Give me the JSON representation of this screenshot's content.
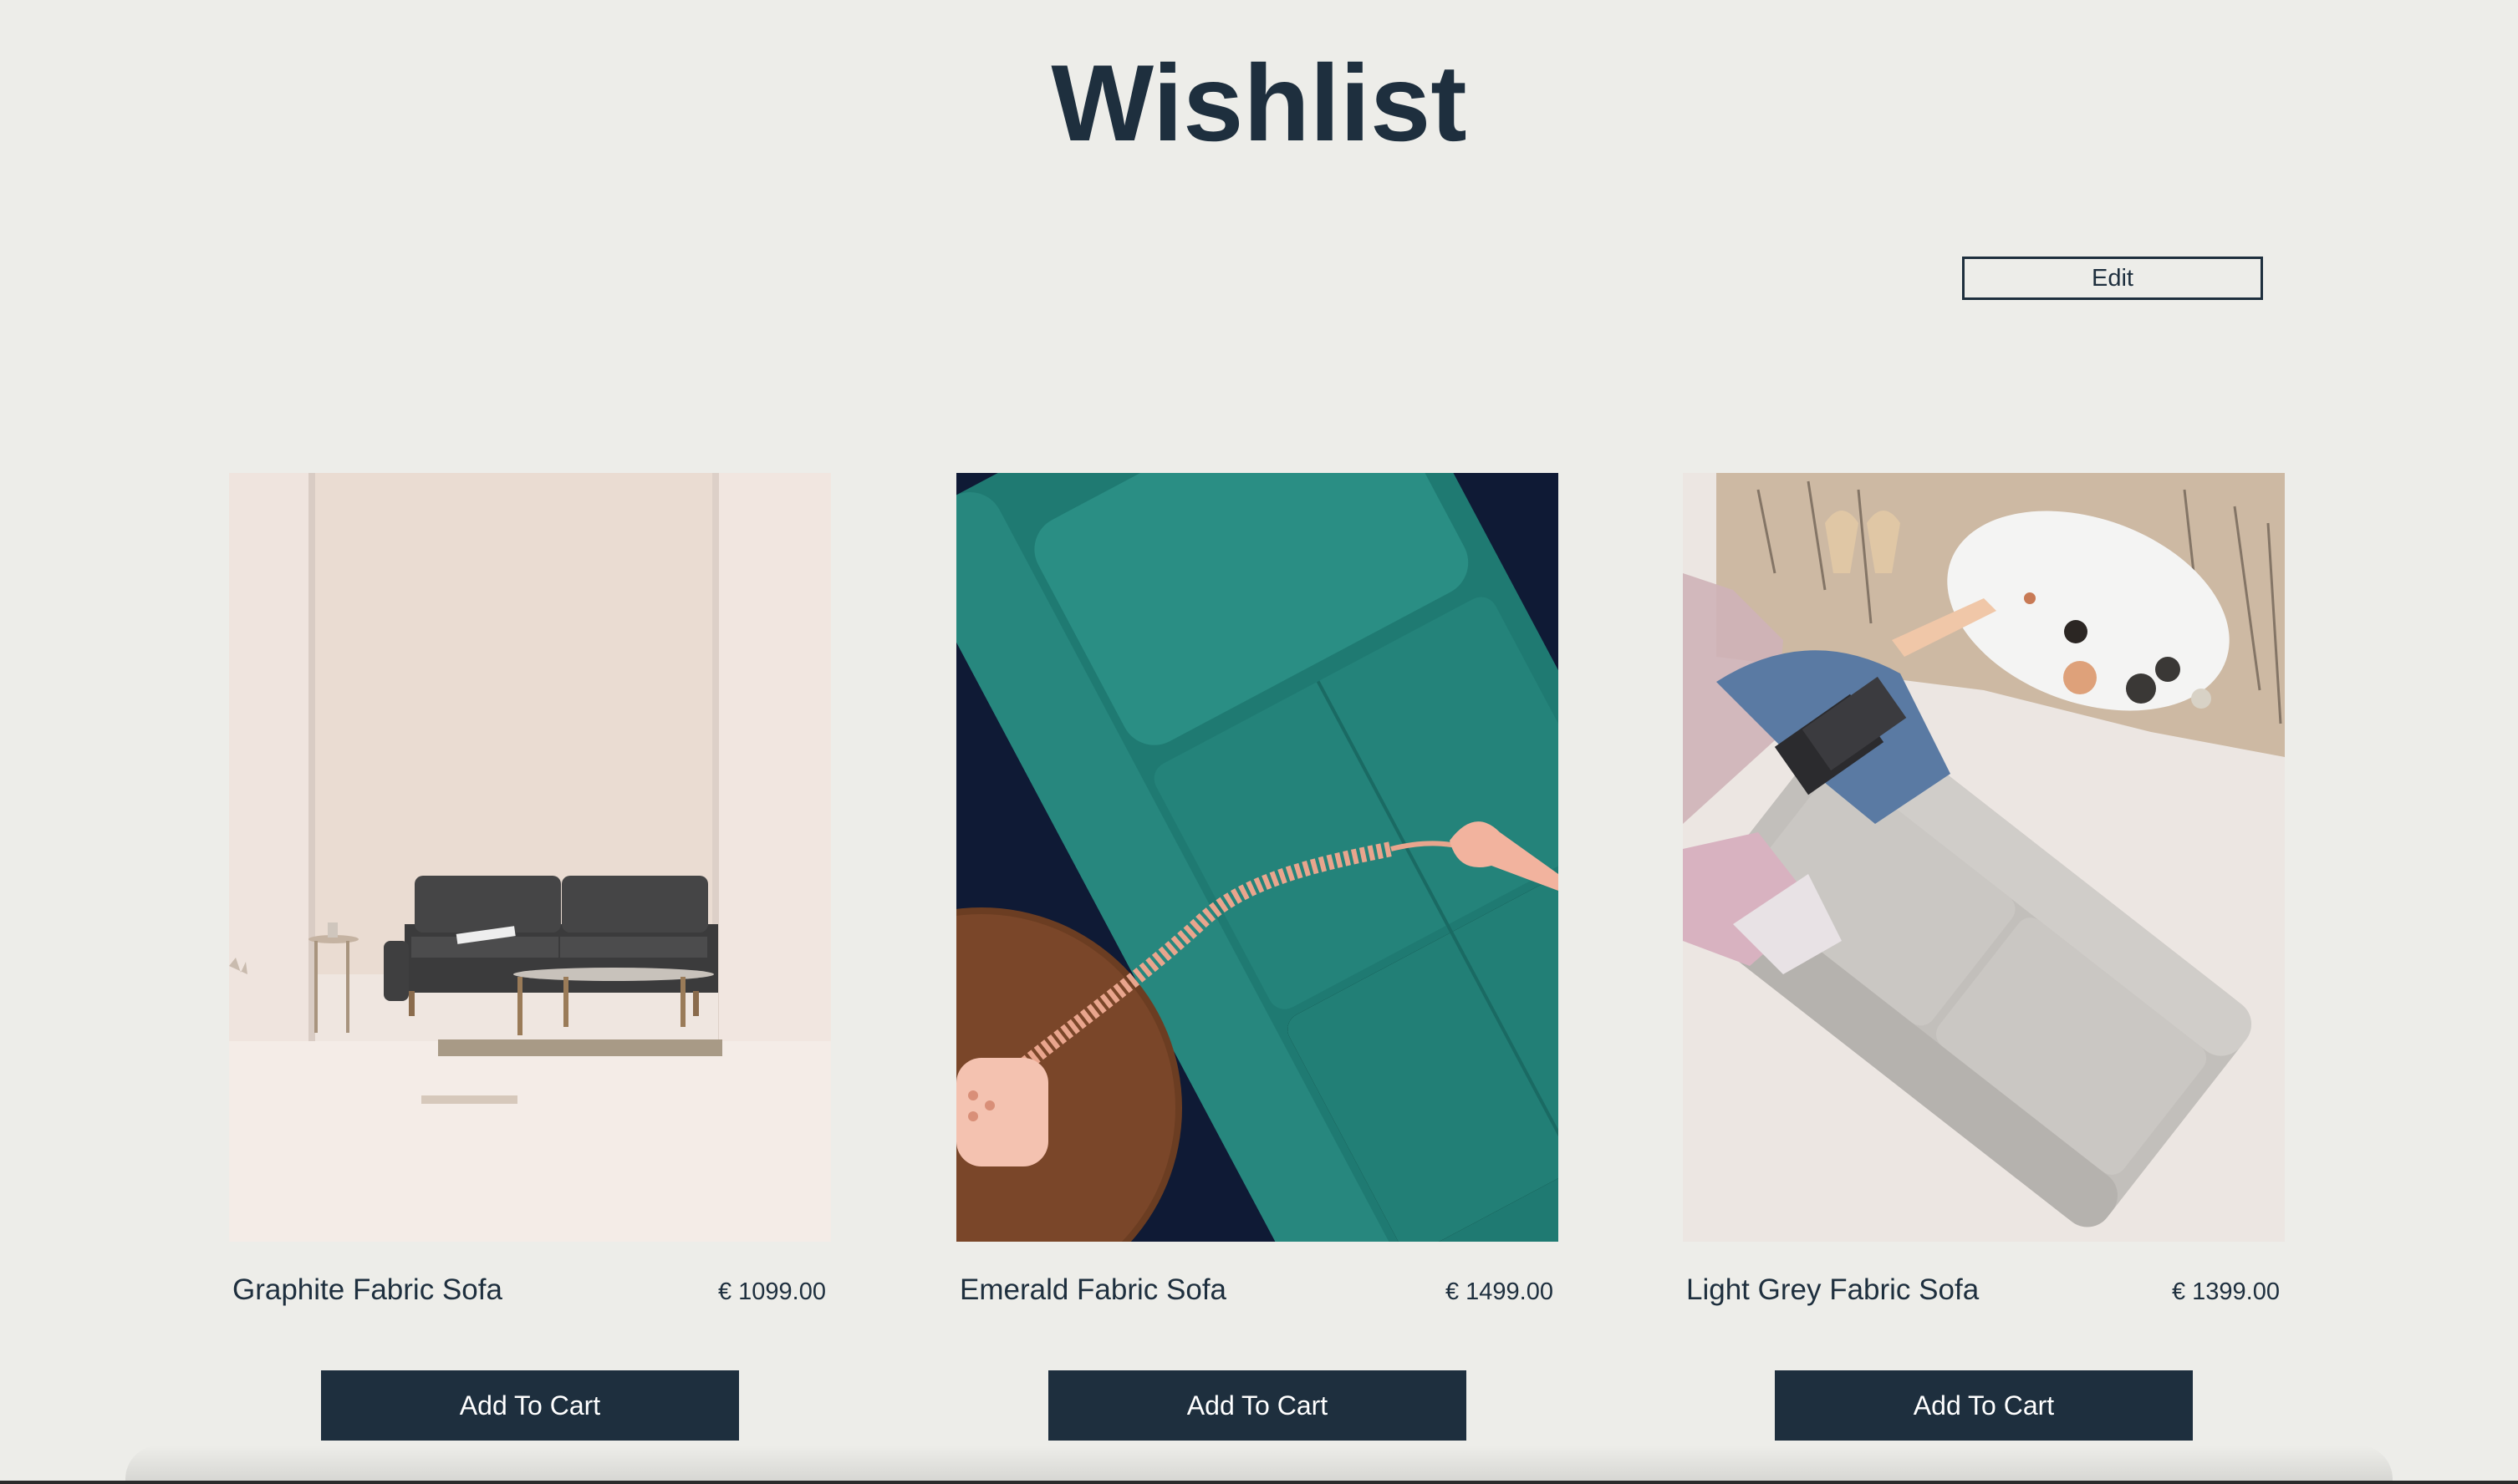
{
  "page": {
    "title": "Wishlist",
    "edit_label": "Edit"
  },
  "colors": {
    "background": "#edede9",
    "primary": "#1e2f3e",
    "button_text": "#ffffff"
  },
  "products": [
    {
      "name": "Graphite Fabric Sofa",
      "price": "€ 1099.00",
      "cart_label": "Add To Cart",
      "image": "graphite-sofa-photo"
    },
    {
      "name": "Emerald Fabric Sofa",
      "price": "€ 1499.00",
      "cart_label": "Add To Cart",
      "image": "emerald-sofa-photo"
    },
    {
      "name": "Light Grey Fabric Sofa",
      "price": "€ 1399.00",
      "cart_label": "Add To Cart",
      "image": "light-grey-sofa-photo"
    }
  ]
}
